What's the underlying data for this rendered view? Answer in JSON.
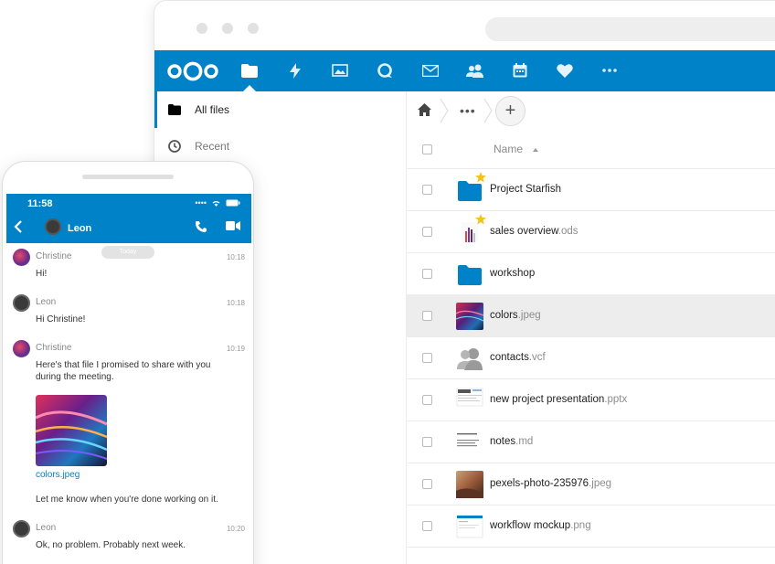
{
  "nav": {
    "items": [
      "files",
      "activity",
      "photos",
      "talk",
      "mail",
      "contacts",
      "calendar",
      "favorites",
      "more"
    ]
  },
  "sidebar": {
    "items": [
      {
        "label": "All files",
        "icon": "folder-icon"
      },
      {
        "label": "Recent",
        "icon": "clock-icon"
      }
    ]
  },
  "files": {
    "column_name": "Name",
    "rows": [
      {
        "name": "Project Starfish",
        "ext": "",
        "type": "folder",
        "starred": true
      },
      {
        "name": "sales overview",
        "ext": ".ods",
        "type": "spreadsheet",
        "starred": true
      },
      {
        "name": "workshop",
        "ext": "",
        "type": "folder",
        "starred": false
      },
      {
        "name": "colors",
        "ext": ".jpeg",
        "type": "image-colors",
        "starred": false,
        "selected": true
      },
      {
        "name": "contacts",
        "ext": ".vcf",
        "type": "contacts",
        "starred": false
      },
      {
        "name": "new project presentation",
        "ext": ".pptx",
        "type": "presentation",
        "starred": false
      },
      {
        "name": "notes",
        "ext": ".md",
        "type": "text",
        "starred": false
      },
      {
        "name": "pexels-photo-235976",
        "ext": ".jpeg",
        "type": "image-photo",
        "starred": false
      },
      {
        "name": "workflow mockup",
        "ext": ".png",
        "type": "mockup",
        "starred": false
      }
    ]
  },
  "phone": {
    "time": "11:58",
    "contact": "Leon",
    "today_label": "Today",
    "messages": [
      {
        "author": "Christine",
        "time": "10:18",
        "text": "Hi!"
      },
      {
        "author": "Leon",
        "time": "10:18",
        "text": "Hi Christine!"
      },
      {
        "author": "Christine",
        "time": "10:19",
        "text": "Here's that file I promised to share with you during the meeting."
      },
      {
        "author": "",
        "time": "",
        "text": "Let me know when you're done working on it."
      },
      {
        "author": "Leon",
        "time": "10:20",
        "text": "Ok, no problem. Probably next week."
      }
    ],
    "attachment": "colors.jpeg"
  },
  "colors": {
    "brand": "#0082c9",
    "star": "#f5c218",
    "folder": "#0082c9"
  }
}
